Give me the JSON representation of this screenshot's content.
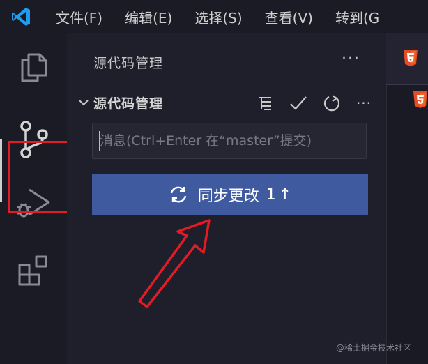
{
  "menu": {
    "items": [
      "文件(F)",
      "编辑(E)",
      "选择(S)",
      "查看(V)",
      "转到(G"
    ]
  },
  "activity_bar": {
    "items": [
      {
        "name": "explorer-icon"
      },
      {
        "name": "source-control-icon",
        "active": true,
        "highlighted": true
      },
      {
        "name": "run-debug-icon"
      },
      {
        "name": "extensions-icon"
      }
    ]
  },
  "sidebar": {
    "title": "源代码管理",
    "more_label": "···",
    "section": {
      "title": "源代码管理",
      "actions": [
        {
          "name": "view-as-tree-icon"
        },
        {
          "name": "commit-check-icon"
        },
        {
          "name": "refresh-icon"
        },
        {
          "name": "more-actions-icon"
        }
      ],
      "more_label": "···"
    },
    "commit_input": {
      "placeholder": "消息(Ctrl+Enter 在“master”提交)",
      "value": ""
    },
    "sync_button": {
      "label": "同步更改",
      "count": "1",
      "arrow": "↑"
    }
  },
  "editor": {
    "tabs": [
      {
        "icon": "html5-icon"
      },
      {
        "icon": "html5-icon"
      }
    ]
  },
  "watermark": "@稀土掘金技术社区",
  "colors": {
    "accent_button": "#3f5a9f",
    "highlight_box": "#e21b25",
    "annotation_arrow": "#e21b25",
    "html5_orange": "#e44d26",
    "vscode_blue": "#1f9cf0"
  }
}
